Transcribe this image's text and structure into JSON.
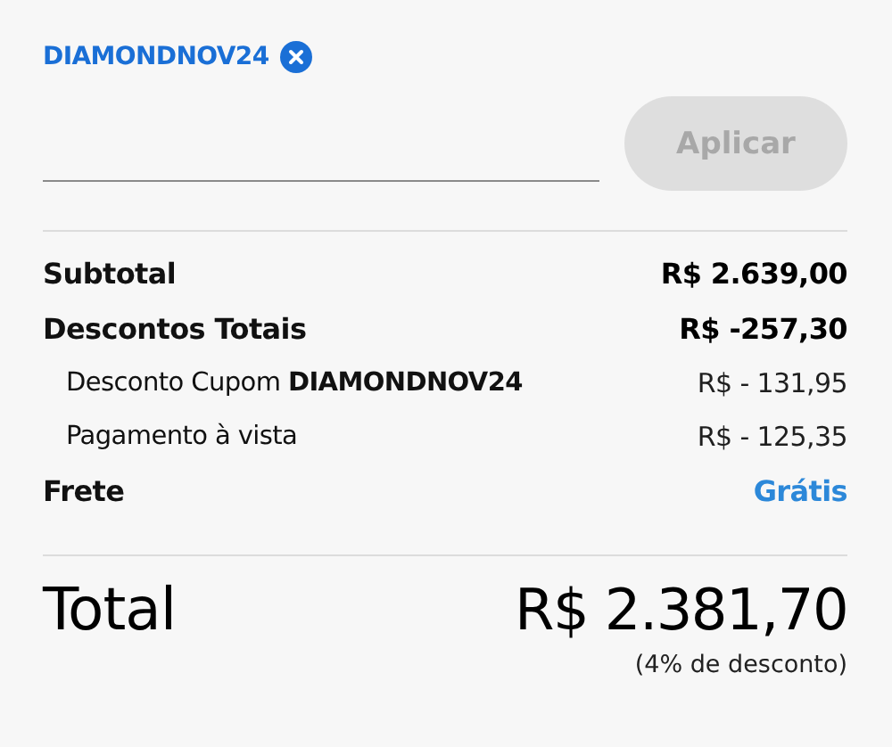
{
  "applied_coupon": {
    "code": "DIAMONDNOV24"
  },
  "apply_button": {
    "label": "Aplicar",
    "disabled": true
  },
  "summary": [
    {
      "kind": "main",
      "label": "Subtotal",
      "value": "R$ 2.639,00",
      "color": "#000000"
    },
    {
      "kind": "main",
      "label": "Descontos Totais",
      "value": "R$ -257,30",
      "color": "#000000"
    },
    {
      "kind": "sub",
      "label": "Desconto Cupom **DIAMONDNOV24**",
      "value": "R$ - 131,95",
      "color": "#1f1f1f"
    },
    {
      "kind": "sub",
      "label": "Pagamento à vista",
      "value": "R$ - 125,35",
      "color": "#1f1f1f"
    },
    {
      "kind": "main",
      "label": "Frete",
      "value": "Grátis",
      "color": "#2c88d9"
    }
  ],
  "total": {
    "label": "Total",
    "value": "R$ 2.381,70",
    "note": "(4% de desconto)"
  }
}
